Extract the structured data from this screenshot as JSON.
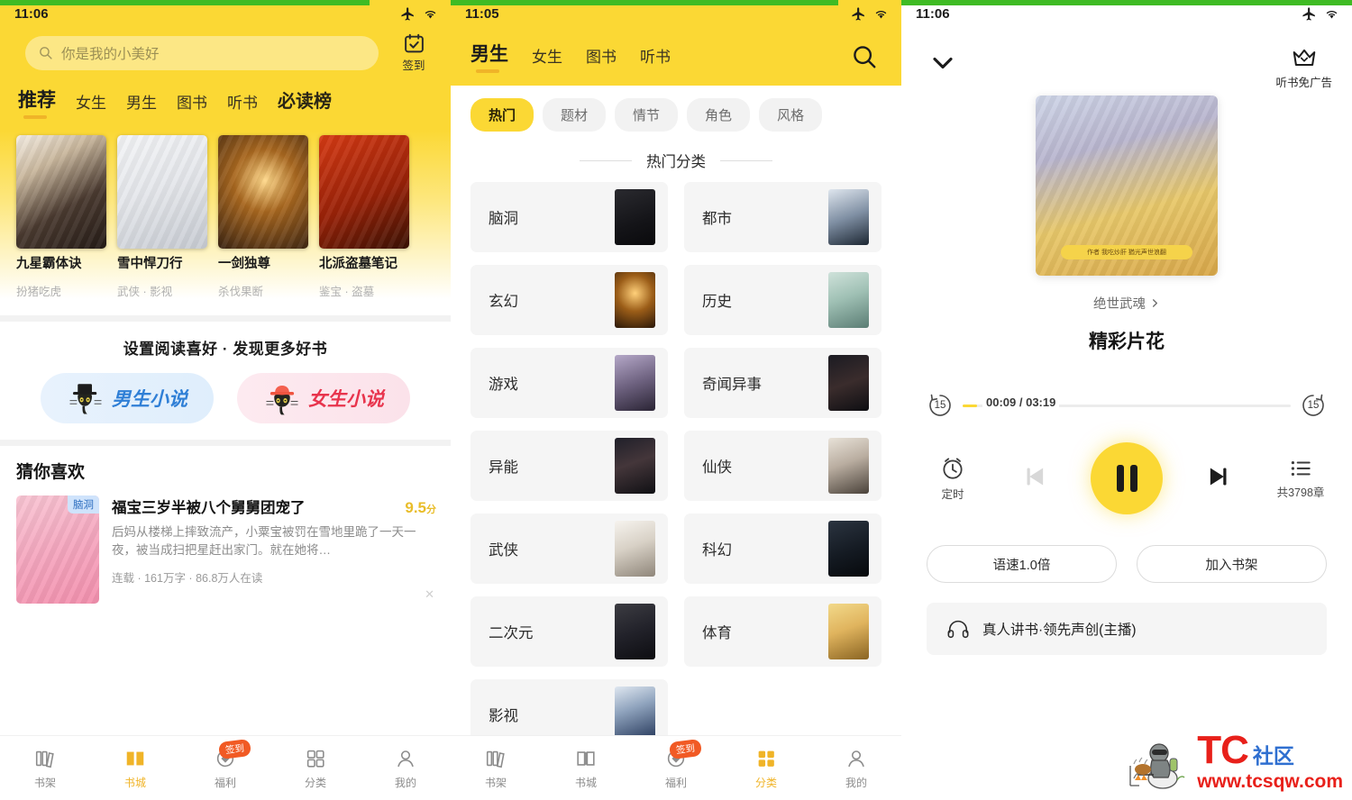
{
  "panel1": {
    "status": {
      "time": "11:06",
      "icons": [
        "airplane-mode-icon",
        "wifi-icon"
      ]
    },
    "search": {
      "placeholder": "你是我的小美好",
      "icon": "search-icon"
    },
    "signin": {
      "label": "签到",
      "icon": "calendar-check-icon"
    },
    "tabs": [
      {
        "label": "推荐",
        "active": true
      },
      {
        "label": "女生",
        "active": false
      },
      {
        "label": "男生",
        "active": false
      },
      {
        "label": "图书",
        "active": false
      },
      {
        "label": "听书",
        "active": false
      },
      {
        "label": "必读榜",
        "active": false
      }
    ],
    "books": [
      {
        "title": "九星霸体诀",
        "sub": "扮猪吃虎"
      },
      {
        "title": "雪中悍刀行",
        "sub": "武侠 · 影视"
      },
      {
        "title": "一剑独尊",
        "sub": "杀伐果断"
      },
      {
        "title": "北派盗墓笔记",
        "sub": "鉴宝 · 盗墓"
      }
    ],
    "pref": {
      "title": "设置阅读喜好 · 发现更多好书",
      "male": {
        "label": "男生小说",
        "icon": "cat-tophat-icon"
      },
      "female": {
        "label": "女生小说",
        "icon": "cat-redhat-icon"
      }
    },
    "guess": {
      "heading": "猜你喜欢",
      "card": {
        "tag": "脑洞",
        "title": "福宝三岁半被八个舅舅团宠了",
        "score": "9.5",
        "score_unit": "分",
        "desc": "后妈从楼梯上摔致流产，小粟宝被罚在雪地里跪了一天一夜，被当成扫把星赶出家门。就在她将…",
        "meta": "连载 · 161万字 · 86.8万人在读",
        "close_icon": "close-icon"
      }
    },
    "tabbar": [
      {
        "label": "书架",
        "icon": "bookshelf-icon",
        "active": false,
        "badge": ""
      },
      {
        "label": "书城",
        "icon": "book-open-icon",
        "active": true,
        "badge": ""
      },
      {
        "label": "福利",
        "icon": "gift-coin-icon",
        "active": false,
        "badge": "签到"
      },
      {
        "label": "分类",
        "icon": "grid-icon",
        "active": false,
        "badge": ""
      },
      {
        "label": "我的",
        "icon": "person-icon",
        "active": false,
        "badge": ""
      }
    ]
  },
  "panel2": {
    "status": {
      "time": "11:05",
      "icons": [
        "airplane-mode-icon",
        "wifi-icon"
      ]
    },
    "tabs": [
      {
        "label": "男生",
        "active": true
      },
      {
        "label": "女生",
        "active": false
      },
      {
        "label": "图书",
        "active": false
      },
      {
        "label": "听书",
        "active": false
      }
    ],
    "search_icon": "search-icon",
    "chips": [
      {
        "label": "热门",
        "active": true
      },
      {
        "label": "题材",
        "active": false
      },
      {
        "label": "情节",
        "active": false
      },
      {
        "label": "角色",
        "active": false
      },
      {
        "label": "风格",
        "active": false
      }
    ],
    "section_title": "热门分类",
    "categories": [
      {
        "name": "脑洞"
      },
      {
        "name": "都市"
      },
      {
        "name": "玄幻"
      },
      {
        "name": "历史"
      },
      {
        "name": "游戏"
      },
      {
        "name": "奇闻异事"
      },
      {
        "name": "异能"
      },
      {
        "name": "仙侠"
      },
      {
        "name": "武侠"
      },
      {
        "name": "科幻"
      },
      {
        "name": "二次元"
      },
      {
        "name": "体育"
      },
      {
        "name": "影视"
      }
    ],
    "tabbar": [
      {
        "label": "书架",
        "icon": "bookshelf-icon",
        "active": false,
        "badge": ""
      },
      {
        "label": "书城",
        "icon": "book-open-icon",
        "active": false,
        "badge": ""
      },
      {
        "label": "福利",
        "icon": "gift-coin-icon",
        "active": false,
        "badge": "签到"
      },
      {
        "label": "分类",
        "icon": "grid-icon",
        "active": true,
        "badge": ""
      },
      {
        "label": "我的",
        "icon": "person-icon",
        "active": false,
        "badge": ""
      }
    ]
  },
  "panel3": {
    "status": {
      "time": "11:06",
      "icons": [
        "airplane-mode-icon",
        "wifi-icon"
      ]
    },
    "collapse_icon": "chevron-down-icon",
    "vip": {
      "label": "听书免广告",
      "icon": "crown-icon"
    },
    "album": {
      "series": "绝世武魂",
      "series_arrow": "chevron-right-icon",
      "chapter": "精彩片花",
      "cover_author_line": "作者  我吃炒肝   猶光声世浪翻"
    },
    "seek": {
      "back_label": "15",
      "forward_label": "15",
      "current": "00:09",
      "total": "03:19",
      "time_display": "00:09 / 03:19",
      "progress_percent": 4.5
    },
    "controls": {
      "timer": {
        "label": "定时",
        "icon": "alarm-clock-icon"
      },
      "prev_icon": "skip-previous-icon",
      "play_state": "pause-icon",
      "next_icon": "skip-next-icon",
      "playlist": {
        "label": "共3798章",
        "icon": "playlist-icon"
      }
    },
    "pills": [
      {
        "label": "语速1.0倍"
      },
      {
        "label": "加入书架"
      }
    ],
    "narrator": {
      "label": "真人讲书·领先声创(主播)",
      "icon": "headphones-icon"
    }
  },
  "watermark": {
    "brand": "TC",
    "suffix": "社区",
    "url": "www.tcsqw.com",
    "icon": "pubg-player-icon"
  },
  "colors": {
    "brand_yellow": "#fbd834",
    "accent_yellow": "#f0b428",
    "badge_orange": "#f15a24",
    "status_green": "#3fbb24",
    "male_blue": "#2f7fd6",
    "female_red": "#e8344d",
    "watermark_red": "#e8201a",
    "watermark_blue": "#2f6fd0"
  }
}
